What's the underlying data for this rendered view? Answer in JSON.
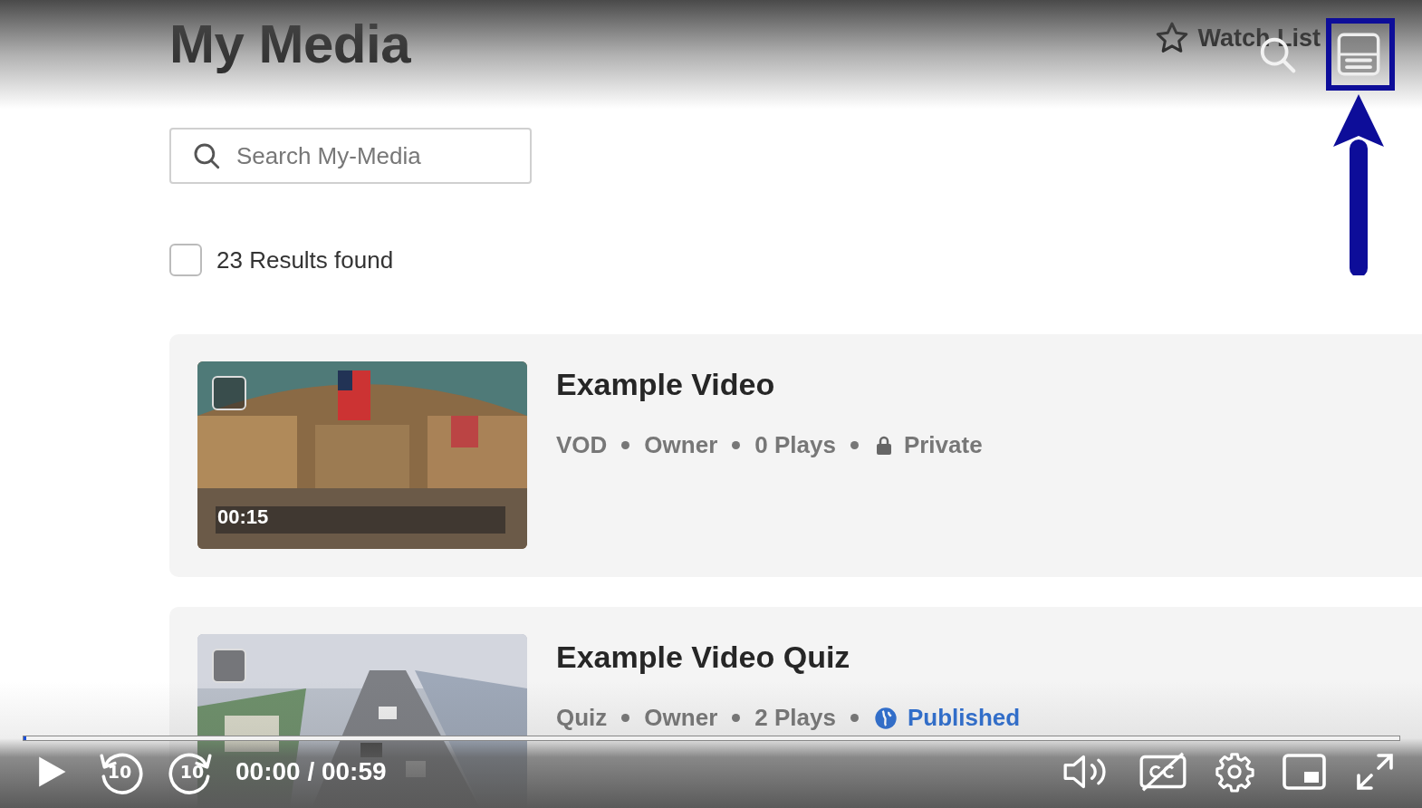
{
  "page": {
    "title": "My Media",
    "watch_list": "Watch List",
    "search": {
      "placeholder": "Search My-Media"
    },
    "results": {
      "label": "23 Results found",
      "checked": false
    }
  },
  "media": [
    {
      "title": "Example Video",
      "duration": "00:15",
      "checked": false,
      "meta": [
        "VOD",
        "Owner",
        "0 Plays"
      ],
      "status": {
        "kind": "private",
        "label": "Private"
      }
    },
    {
      "title": "Example Video Quiz",
      "checked": false,
      "meta": [
        "Quiz",
        "Owner",
        "2 Plays"
      ],
      "status": {
        "kind": "published",
        "label": "Published"
      }
    }
  ],
  "player": {
    "playing": false,
    "skip_back": "10",
    "skip_forward": "10",
    "time": "00:00 / 00:59",
    "progress": {
      "level": 0.002
    },
    "captions_on": false
  }
}
